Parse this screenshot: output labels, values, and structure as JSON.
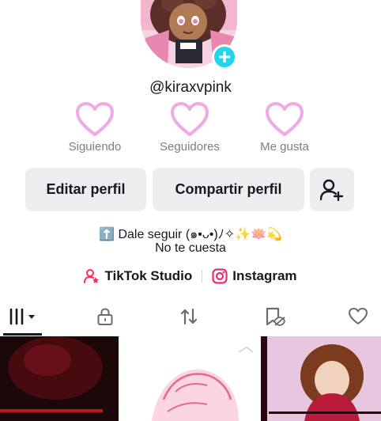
{
  "profile": {
    "username": "@kiraxvpink",
    "stats": [
      {
        "label": "Siguiendo"
      },
      {
        "label": "Seguidores"
      },
      {
        "label": "Me gusta"
      }
    ],
    "buttons": {
      "edit": "Editar perfil",
      "share": "Compartir perfil"
    },
    "bio": {
      "line1": "⬆️ Dale seguir (๑•ᴗ•)ﾉ✧✨🪷💫",
      "line2": "No te cuesta"
    },
    "links": {
      "studio": "TikTok Studio",
      "instagram": "Instagram"
    }
  },
  "icons": {
    "add": "plus-icon",
    "heart": "heart-outline-icon",
    "add_friend": "add-user-icon",
    "studio": "tiktok-studio-icon",
    "instagram": "instagram-icon",
    "tabs": [
      "grid-icon",
      "lock-icon",
      "repost-icon",
      "hidden-bookmark-icon",
      "heart-icon"
    ]
  },
  "colors": {
    "accent_cyan": "#20d5ec",
    "heart_pink": "#f1a9e6",
    "button_bg": "#eeeef0",
    "studio_red": "#fe2c55"
  }
}
